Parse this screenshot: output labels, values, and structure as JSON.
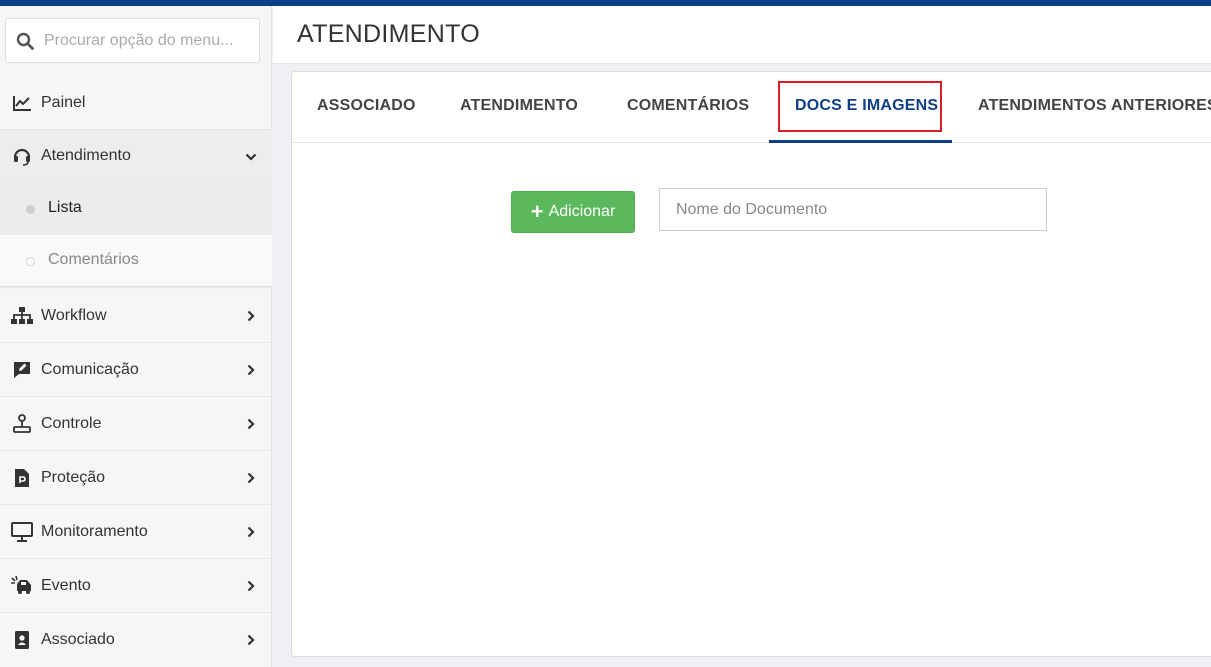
{
  "search": {
    "placeholder": "Procurar opção do menu..."
  },
  "sidebar": {
    "items": [
      {
        "label": "Painel",
        "icon": "chart-line-icon"
      },
      {
        "label": "Atendimento",
        "icon": "headset-icon",
        "expanded": true,
        "children": [
          {
            "label": "Lista",
            "current": true
          },
          {
            "label": "Comentários"
          }
        ]
      },
      {
        "label": "Workflow",
        "icon": "sitemap-icon"
      },
      {
        "label": "Comunicação",
        "icon": "comment-edit-icon"
      },
      {
        "label": "Controle",
        "icon": "joystick-icon"
      },
      {
        "label": "Proteção",
        "icon": "file-p-icon"
      },
      {
        "label": "Monitoramento",
        "icon": "monitor-icon"
      },
      {
        "label": "Evento",
        "icon": "car-crash-icon"
      },
      {
        "label": "Associado",
        "icon": "contact-book-icon"
      }
    ]
  },
  "header": {
    "title": "ATENDIMENTO"
  },
  "tabs": [
    {
      "label": "ASSOCIADO"
    },
    {
      "label": "ATENDIMENTO"
    },
    {
      "label": "COMENTÁRIOS"
    },
    {
      "label": "DOCS E IMAGENS",
      "active": true
    },
    {
      "label": "ATENDIMENTOS ANTERIORES"
    }
  ],
  "docs": {
    "add_label": "Adicionar",
    "name_placeholder": "Nome do Documento"
  },
  "colors": {
    "brand": "#0d3f86",
    "success": "#5cb85c",
    "highlight": "#d61f26"
  }
}
